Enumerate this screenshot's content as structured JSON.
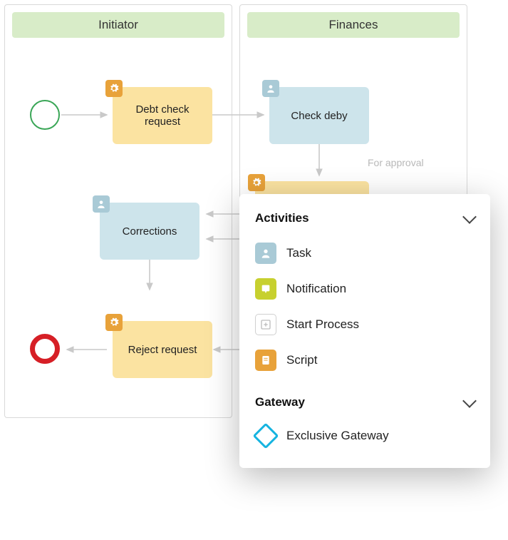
{
  "lanes": {
    "initiator": {
      "title": "Initiator"
    },
    "finances": {
      "title": "Finances"
    }
  },
  "events": {
    "start": {
      "name": "start-event"
    },
    "end": {
      "name": "end-event"
    }
  },
  "tasks": {
    "debt_check": {
      "label": "Debt check request",
      "type": "system"
    },
    "check_deby": {
      "label": "Check deby",
      "type": "user"
    },
    "corrections": {
      "label": "Corrections",
      "type": "user"
    },
    "reject": {
      "label": "Reject request",
      "type": "system"
    },
    "hidden_sys": {
      "label": "",
      "type": "system"
    }
  },
  "edge_labels": {
    "for_approval": "For approval"
  },
  "palette": {
    "sections": {
      "activities": {
        "title": "Activities",
        "items": {
          "task": {
            "label": "Task",
            "icon": "task"
          },
          "notification": {
            "label": "Notification",
            "icon": "notification"
          },
          "start_process": {
            "label": "Start Process",
            "icon": "start-process"
          },
          "script": {
            "label": "Script",
            "icon": "script"
          }
        }
      },
      "gateway": {
        "title": "Gateway",
        "items": {
          "exclusive": {
            "label": "Exclusive Gateway",
            "icon": "exclusive-gateway"
          }
        }
      }
    }
  }
}
